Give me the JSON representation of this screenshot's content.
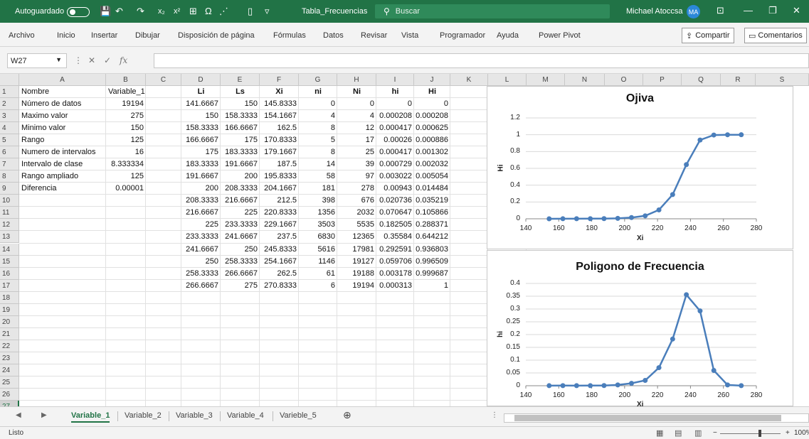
{
  "titlebar": {
    "autosave_label": "Autoguardado",
    "file_title": "Tabla_Frecuencias",
    "search_placeholder": "Buscar",
    "user_name": "Michael Atoccsa",
    "user_initials": "MA"
  },
  "ribbon": {
    "tabs": [
      "Archivo",
      "Inicio",
      "Insertar",
      "Dibujar",
      "Disposición de página",
      "Fórmulas",
      "Datos",
      "Revisar",
      "Vista",
      "Programador",
      "Ayuda",
      "Power Pivot"
    ],
    "share_label": "Compartir",
    "comments_label": "Comentarios"
  },
  "formula_bar": {
    "name_box": "W27",
    "fx_label": "fx"
  },
  "columns": [
    "A",
    "B",
    "C",
    "D",
    "E",
    "F",
    "G",
    "H",
    "I",
    "J",
    "K",
    "L",
    "M",
    "N",
    "O",
    "P",
    "Q",
    "R",
    "S"
  ],
  "rows": [
    "1",
    "2",
    "3",
    "4",
    "5",
    "6",
    "7",
    "8",
    "9",
    "10",
    "11",
    "12",
    "13",
    "14",
    "15",
    "16",
    "17",
    "18",
    "19",
    "20",
    "21",
    "22",
    "23",
    "24",
    "25",
    "26",
    "27"
  ],
  "summary": [
    {
      "label": "Nombre",
      "value": "Variable_1"
    },
    {
      "label": "Número de datos",
      "value": "19194"
    },
    {
      "label": "Maximo valor",
      "value": "275"
    },
    {
      "label": "Minimo valor",
      "value": "150"
    },
    {
      "label": "Rango",
      "value": "125"
    },
    {
      "label": "Numero de intervalos",
      "value": "16"
    },
    {
      "label": "Intervalo de clase",
      "value": "8.333334"
    },
    {
      "label": "Rango ampliado",
      "value": "125"
    },
    {
      "label": "Diferencia",
      "value": "0.00001"
    }
  ],
  "freq_table": {
    "headers": [
      "Li",
      "Ls",
      "Xi",
      "ni",
      "Ni",
      "hi",
      "Hi"
    ],
    "rows": [
      [
        "141.6667",
        "150",
        "145.8333",
        "0",
        "0",
        "0",
        "0"
      ],
      [
        "150",
        "158.3333",
        "154.1667",
        "4",
        "4",
        "0.000208",
        "0.000208"
      ],
      [
        "158.3333",
        "166.6667",
        "162.5",
        "8",
        "12",
        "0.000417",
        "0.000625"
      ],
      [
        "166.6667",
        "175",
        "170.8333",
        "5",
        "17",
        "0.00026",
        "0.000886"
      ],
      [
        "175",
        "183.3333",
        "179.1667",
        "8",
        "25",
        "0.000417",
        "0.001302"
      ],
      [
        "183.3333",
        "191.6667",
        "187.5",
        "14",
        "39",
        "0.000729",
        "0.002032"
      ],
      [
        "191.6667",
        "200",
        "195.8333",
        "58",
        "97",
        "0.003022",
        "0.005054"
      ],
      [
        "200",
        "208.3333",
        "204.1667",
        "181",
        "278",
        "0.00943",
        "0.014484"
      ],
      [
        "208.3333",
        "216.6667",
        "212.5",
        "398",
        "676",
        "0.020736",
        "0.035219"
      ],
      [
        "216.6667",
        "225",
        "220.8333",
        "1356",
        "2032",
        "0.070647",
        "0.105866"
      ],
      [
        "225",
        "233.3333",
        "229.1667",
        "3503",
        "5535",
        "0.182505",
        "0.288371"
      ],
      [
        "233.3333",
        "241.6667",
        "237.5",
        "6830",
        "12365",
        "0.35584",
        "0.644212"
      ],
      [
        "241.6667",
        "250",
        "245.8333",
        "5616",
        "17981",
        "0.292591",
        "0.936803"
      ],
      [
        "250",
        "258.3333",
        "254.1667",
        "1146",
        "19127",
        "0.059706",
        "0.996509"
      ],
      [
        "258.3333",
        "266.6667",
        "262.5",
        "61",
        "19188",
        "0.003178",
        "0.999687"
      ],
      [
        "266.6667",
        "275",
        "270.8333",
        "6",
        "19194",
        "0.000313",
        "1"
      ]
    ]
  },
  "chart_data": [
    {
      "type": "line",
      "title": "Ojiva",
      "xlabel": "Xi",
      "ylabel": "Hi",
      "xlim": [
        140,
        280
      ],
      "ylim": [
        0,
        1.2
      ],
      "xticks": [
        "140",
        "160",
        "180",
        "200",
        "220",
        "240",
        "260",
        "280"
      ],
      "yticks": [
        "0",
        "0.2",
        "0.4",
        "0.6",
        "0.8",
        "1",
        "1.2"
      ],
      "grid": true,
      "color": "#4a7ebb",
      "x": [
        154.1667,
        162.5,
        170.8333,
        179.1667,
        187.5,
        195.8333,
        204.1667,
        212.5,
        220.8333,
        229.1667,
        237.5,
        245.8333,
        254.1667,
        262.5,
        270.8333
      ],
      "y": [
        0.000208,
        0.000625,
        0.000886,
        0.001302,
        0.002032,
        0.005054,
        0.014484,
        0.035219,
        0.105866,
        0.288371,
        0.644212,
        0.936803,
        0.996509,
        0.999687,
        1
      ]
    },
    {
      "type": "line",
      "title": "Poligono de Frecuencia",
      "xlabel": "Xi",
      "ylabel": "hi",
      "xlim": [
        140,
        280
      ],
      "ylim": [
        0,
        0.4
      ],
      "xticks": [
        "140",
        "160",
        "180",
        "200",
        "220",
        "240",
        "260",
        "280"
      ],
      "yticks": [
        "0",
        "0.05",
        "0.1",
        "0.15",
        "0.2",
        "0.25",
        "0.3",
        "0.35",
        "0.4"
      ],
      "grid": true,
      "color": "#4a7ebb",
      "x": [
        154.1667,
        162.5,
        170.8333,
        179.1667,
        187.5,
        195.8333,
        204.1667,
        212.5,
        220.8333,
        229.1667,
        237.5,
        245.8333,
        254.1667,
        262.5,
        270.8333
      ],
      "y": [
        0.000208,
        0.000417,
        0.00026,
        0.000417,
        0.000729,
        0.003022,
        0.00943,
        0.020736,
        0.070647,
        0.182505,
        0.35584,
        0.292591,
        0.059706,
        0.003178,
        0.000313
      ]
    }
  ],
  "sheet_tabs": [
    "Variable_1",
    "Variable_2",
    "Variable_3",
    "Variable_4",
    "Varieble_5"
  ],
  "status": {
    "text": "Listo",
    "zoom": "100%"
  },
  "colors": {
    "excel_green": "#217346",
    "series_blue": "#4a7ebb"
  }
}
